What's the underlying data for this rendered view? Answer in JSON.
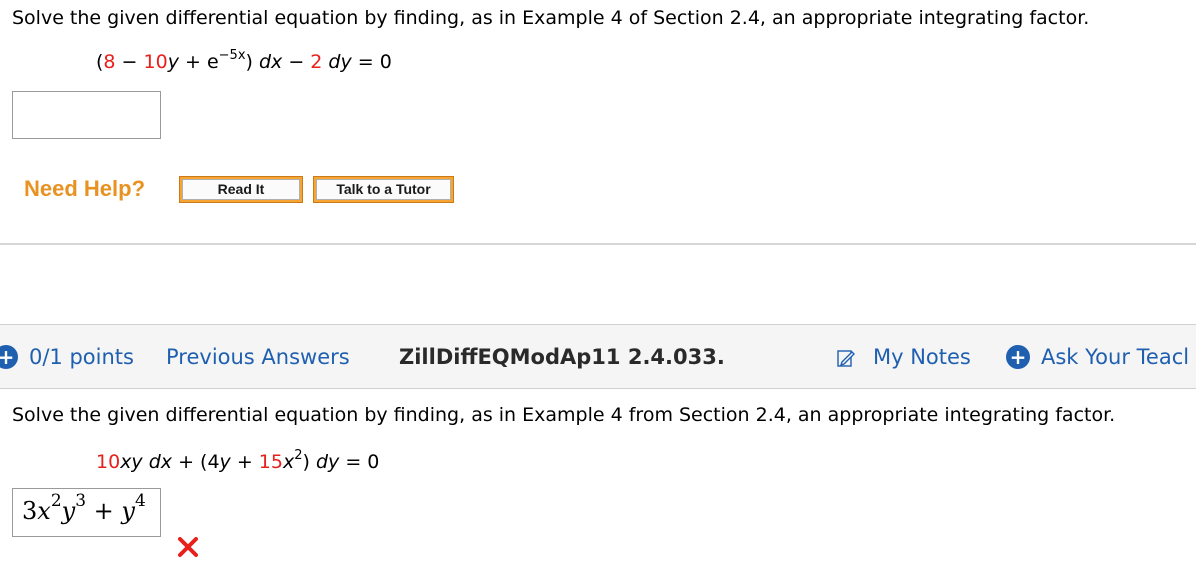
{
  "question1": {
    "prompt": "Solve the given differential equation by finding, as in Example 4 of Section 2.4, an appropriate integrating factor.",
    "equation": {
      "open": "(",
      "c1": "8",
      "minus1": " − ",
      "c2": "10",
      "y": "y",
      "plus": " + e",
      "exp": "−5x",
      "close": ")",
      "dx": " dx",
      "minus2": " − ",
      "c3": "2",
      "dy": " dy",
      "eq": " = 0"
    },
    "answer_value": ""
  },
  "help": {
    "label": "Need Help?",
    "read_it": "Read It",
    "talk_tutor": "Talk to a Tutor"
  },
  "question2_bar": {
    "points": "0/1 points",
    "previous_answers": "Previous Answers",
    "question_id": "ZillDiffEQModAp11 2.4.033.",
    "my_notes": "My Notes",
    "ask_teacher": "Ask Your Teacl"
  },
  "question2": {
    "prompt": "Solve the given differential equation by finding, as in Example 4 from Section 2.4, an appropriate integrating factor.",
    "equation": {
      "c1": "10",
      "xy_dx": "xy dx",
      "mid": " + (4",
      "y": "y",
      "plus": " + ",
      "c2": "15",
      "x": "x",
      "exp": "2",
      "close": ")",
      "dy": " dy",
      "eq": " = 0"
    },
    "answer": {
      "coef": "3",
      "x": "x",
      "xexp": "2",
      "y": "y",
      "yexp": "3",
      "plus": " + ",
      "y2": "y",
      "y2exp": "4"
    },
    "status": "incorrect"
  },
  "colors": {
    "accent_blue": "#1f5fb0",
    "red": "#e8201c",
    "help_orange": "#e89321"
  },
  "icons": {
    "points": "plus-circle-icon",
    "notes": "notes-icon",
    "ask": "plus-circle-icon",
    "status": "x-mark-icon"
  }
}
